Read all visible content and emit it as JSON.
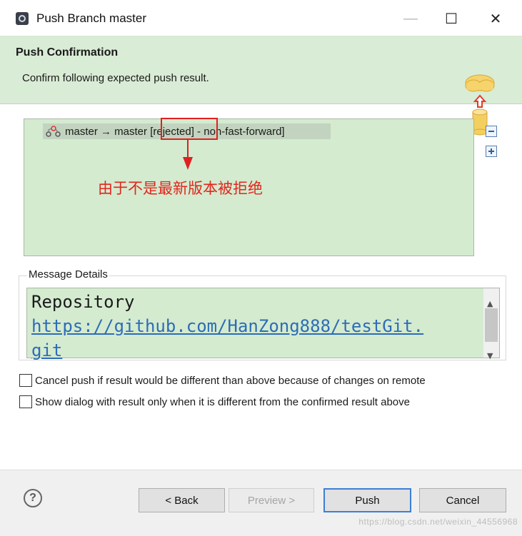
{
  "window": {
    "title": "Push Branch master",
    "minimize_glyph": "—",
    "maximize_glyph": "☐",
    "close_glyph": "✕"
  },
  "header": {
    "title": "Push Confirmation",
    "subtitle": "Confirm following expected push result.",
    "icon": "cloud-upload-database-icon"
  },
  "results": {
    "row_prefix": "master → master ",
    "row_status": "[rejected]",
    "row_suffix": " - non-fast-forward]",
    "row_icon": "branch-icon",
    "annotation": "由于不是最新版本被拒绝",
    "collapse_icon": "collapse-all-icon",
    "expand_icon": "expand-all-icon"
  },
  "message": {
    "label": "Message Details",
    "line1": "Repository",
    "link": "https://github.com/HanZong888/testGit.",
    "line3": "git"
  },
  "options": [
    {
      "label": "Cancel push if result would be different than above because of changes on remote",
      "checked": false
    },
    {
      "label": "Show dialog with result only when it is different from the confirmed result above",
      "checked": false
    }
  ],
  "footer": {
    "help_glyph": "?",
    "back": "< Back",
    "preview": "Preview >",
    "push": "Push",
    "cancel": "Cancel",
    "watermark": "https://blog.csdn.net/weixin_44556968"
  },
  "colors": {
    "header_bg": "#d9ecd5",
    "tree_bg": "#d4ebd0",
    "annotation": "#e1261c",
    "link": "#2d6cb6",
    "default_button_border": "#3c7fd6"
  }
}
